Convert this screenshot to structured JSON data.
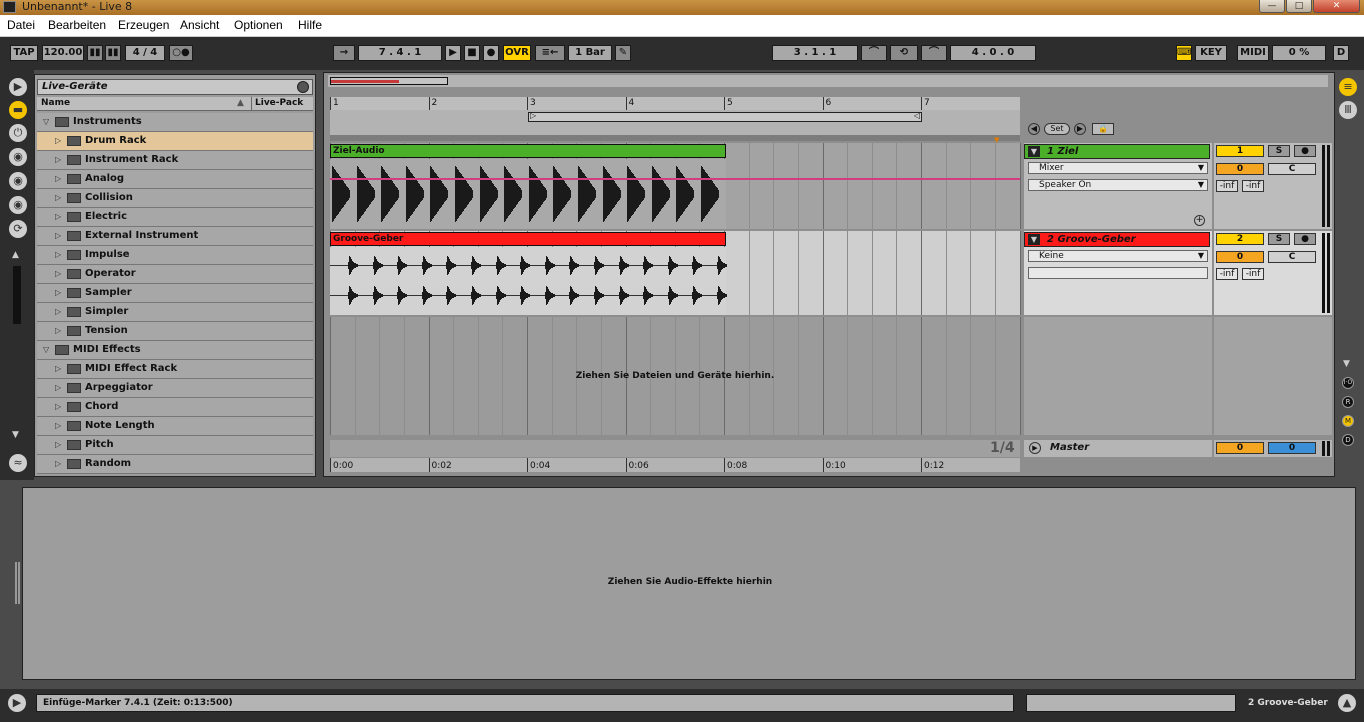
{
  "window": {
    "title": "Unbenannt* - Live 8"
  },
  "menu": [
    "Datei",
    "Bearbeiten",
    "Erzeugen",
    "Ansicht",
    "Optionen",
    "Hilfe"
  ],
  "transport": {
    "tap": "TAP",
    "tempo": "120.00",
    "signature": "4 / 4",
    "position": "7 .  4 .  1",
    "ovr": "OVR",
    "quantize": "1 Bar",
    "loop_start": "3 .  1 .  1",
    "loop_length": "4 .  0 .  0",
    "key": "KEY",
    "midi": "MIDI",
    "cpu": "0 %",
    "d": "D"
  },
  "browser": {
    "title": "Live-Geräte",
    "col_name": "Name",
    "col_pack": "Live-Pack",
    "items": [
      {
        "label": "Instruments",
        "level": 0,
        "open": true
      },
      {
        "label": "Drum Rack",
        "level": 1,
        "selected": true
      },
      {
        "label": "Instrument Rack",
        "level": 1
      },
      {
        "label": "Analog",
        "level": 1
      },
      {
        "label": "Collision",
        "level": 1
      },
      {
        "label": "Electric",
        "level": 1
      },
      {
        "label": "External Instrument",
        "level": 1
      },
      {
        "label": "Impulse",
        "level": 1
      },
      {
        "label": "Operator",
        "level": 1
      },
      {
        "label": "Sampler",
        "level": 1
      },
      {
        "label": "Simpler",
        "level": 1
      },
      {
        "label": "Tension",
        "level": 1
      },
      {
        "label": "MIDI Effects",
        "level": 0,
        "open": true
      },
      {
        "label": "MIDI Effect Rack",
        "level": 1
      },
      {
        "label": "Arpeggiator",
        "level": 1
      },
      {
        "label": "Chord",
        "level": 1
      },
      {
        "label": "Note Length",
        "level": 1
      },
      {
        "label": "Pitch",
        "level": 1
      },
      {
        "label": "Random",
        "level": 1
      }
    ]
  },
  "arrangement": {
    "bars": [
      "1",
      "2",
      "3",
      "4",
      "5",
      "6",
      "7"
    ],
    "times": [
      "0:00",
      "0:02",
      "0:04",
      "0:06",
      "0:08",
      "0:10",
      "0:12"
    ],
    "set_label": "Set",
    "drop_hint": "Ziehen Sie Dateien und Geräte hierhin.",
    "zoom": "1/4",
    "tracks": [
      {
        "clip": "Ziel-Audio",
        "name": "1 Ziel",
        "dd1": "Mixer",
        "dd2": "Speaker On",
        "number": "1",
        "volume": "0",
        "pan": "C",
        "peak_l": "-inf",
        "peak_r": "-inf",
        "color": "#4caf2a"
      },
      {
        "clip": "Groove-Geber",
        "name": "2 Groove-Geber",
        "dd1": "Keine",
        "dd2": "",
        "number": "2",
        "volume": "0",
        "pan": "C",
        "peak_l": "-inf",
        "peak_r": "-inf",
        "color": "#ff1a1a"
      }
    ],
    "master": {
      "name": "Master",
      "volume": "0",
      "cue": "0"
    },
    "solo": "S"
  },
  "device": {
    "drop_hint": "Ziehen Sie Audio-Effekte hierhin"
  },
  "status": {
    "message": "Einfüge-Marker 7.4.1 (Zeit: 0:13:500)",
    "track": "2 Groove-Geber"
  },
  "side_labels": [
    "I·O",
    "R",
    "M",
    "D"
  ]
}
